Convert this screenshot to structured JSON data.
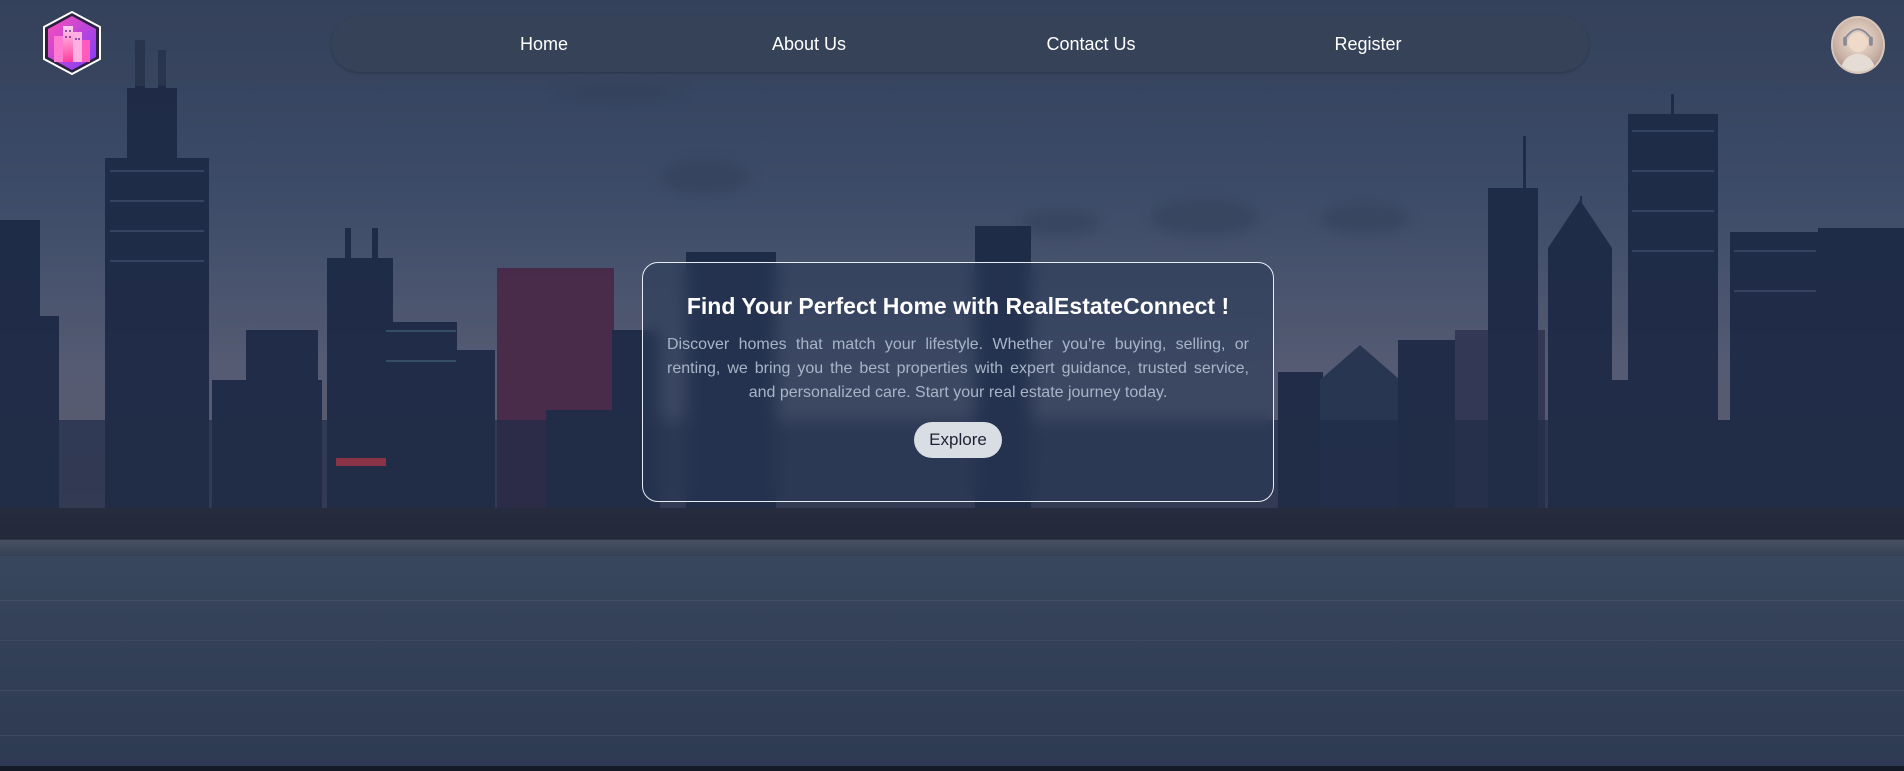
{
  "nav": {
    "items": [
      {
        "label": "Home"
      },
      {
        "label": "About Us"
      },
      {
        "label": "Contact Us"
      },
      {
        "label": "Register"
      }
    ]
  },
  "header": {
    "logo_icon": "city-buildings-hexagon-logo",
    "avatar_icon": "user-avatar-portrait"
  },
  "hero": {
    "title": "Find Your Perfect Home with RealEstateConnect !",
    "description": "Discover homes that match your lifestyle. Whether you're buying, selling, or renting, we bring you the best properties with expert guidance, trusted service, and personalized care. Start your real estate journey today.",
    "button_label": "Explore"
  },
  "colors": {
    "nav_background": "#364257",
    "nav_text": "#ffffff",
    "hero_border": "#e8ecf4",
    "hero_text": "#a9b4c8",
    "button_background": "#d9dde4"
  }
}
